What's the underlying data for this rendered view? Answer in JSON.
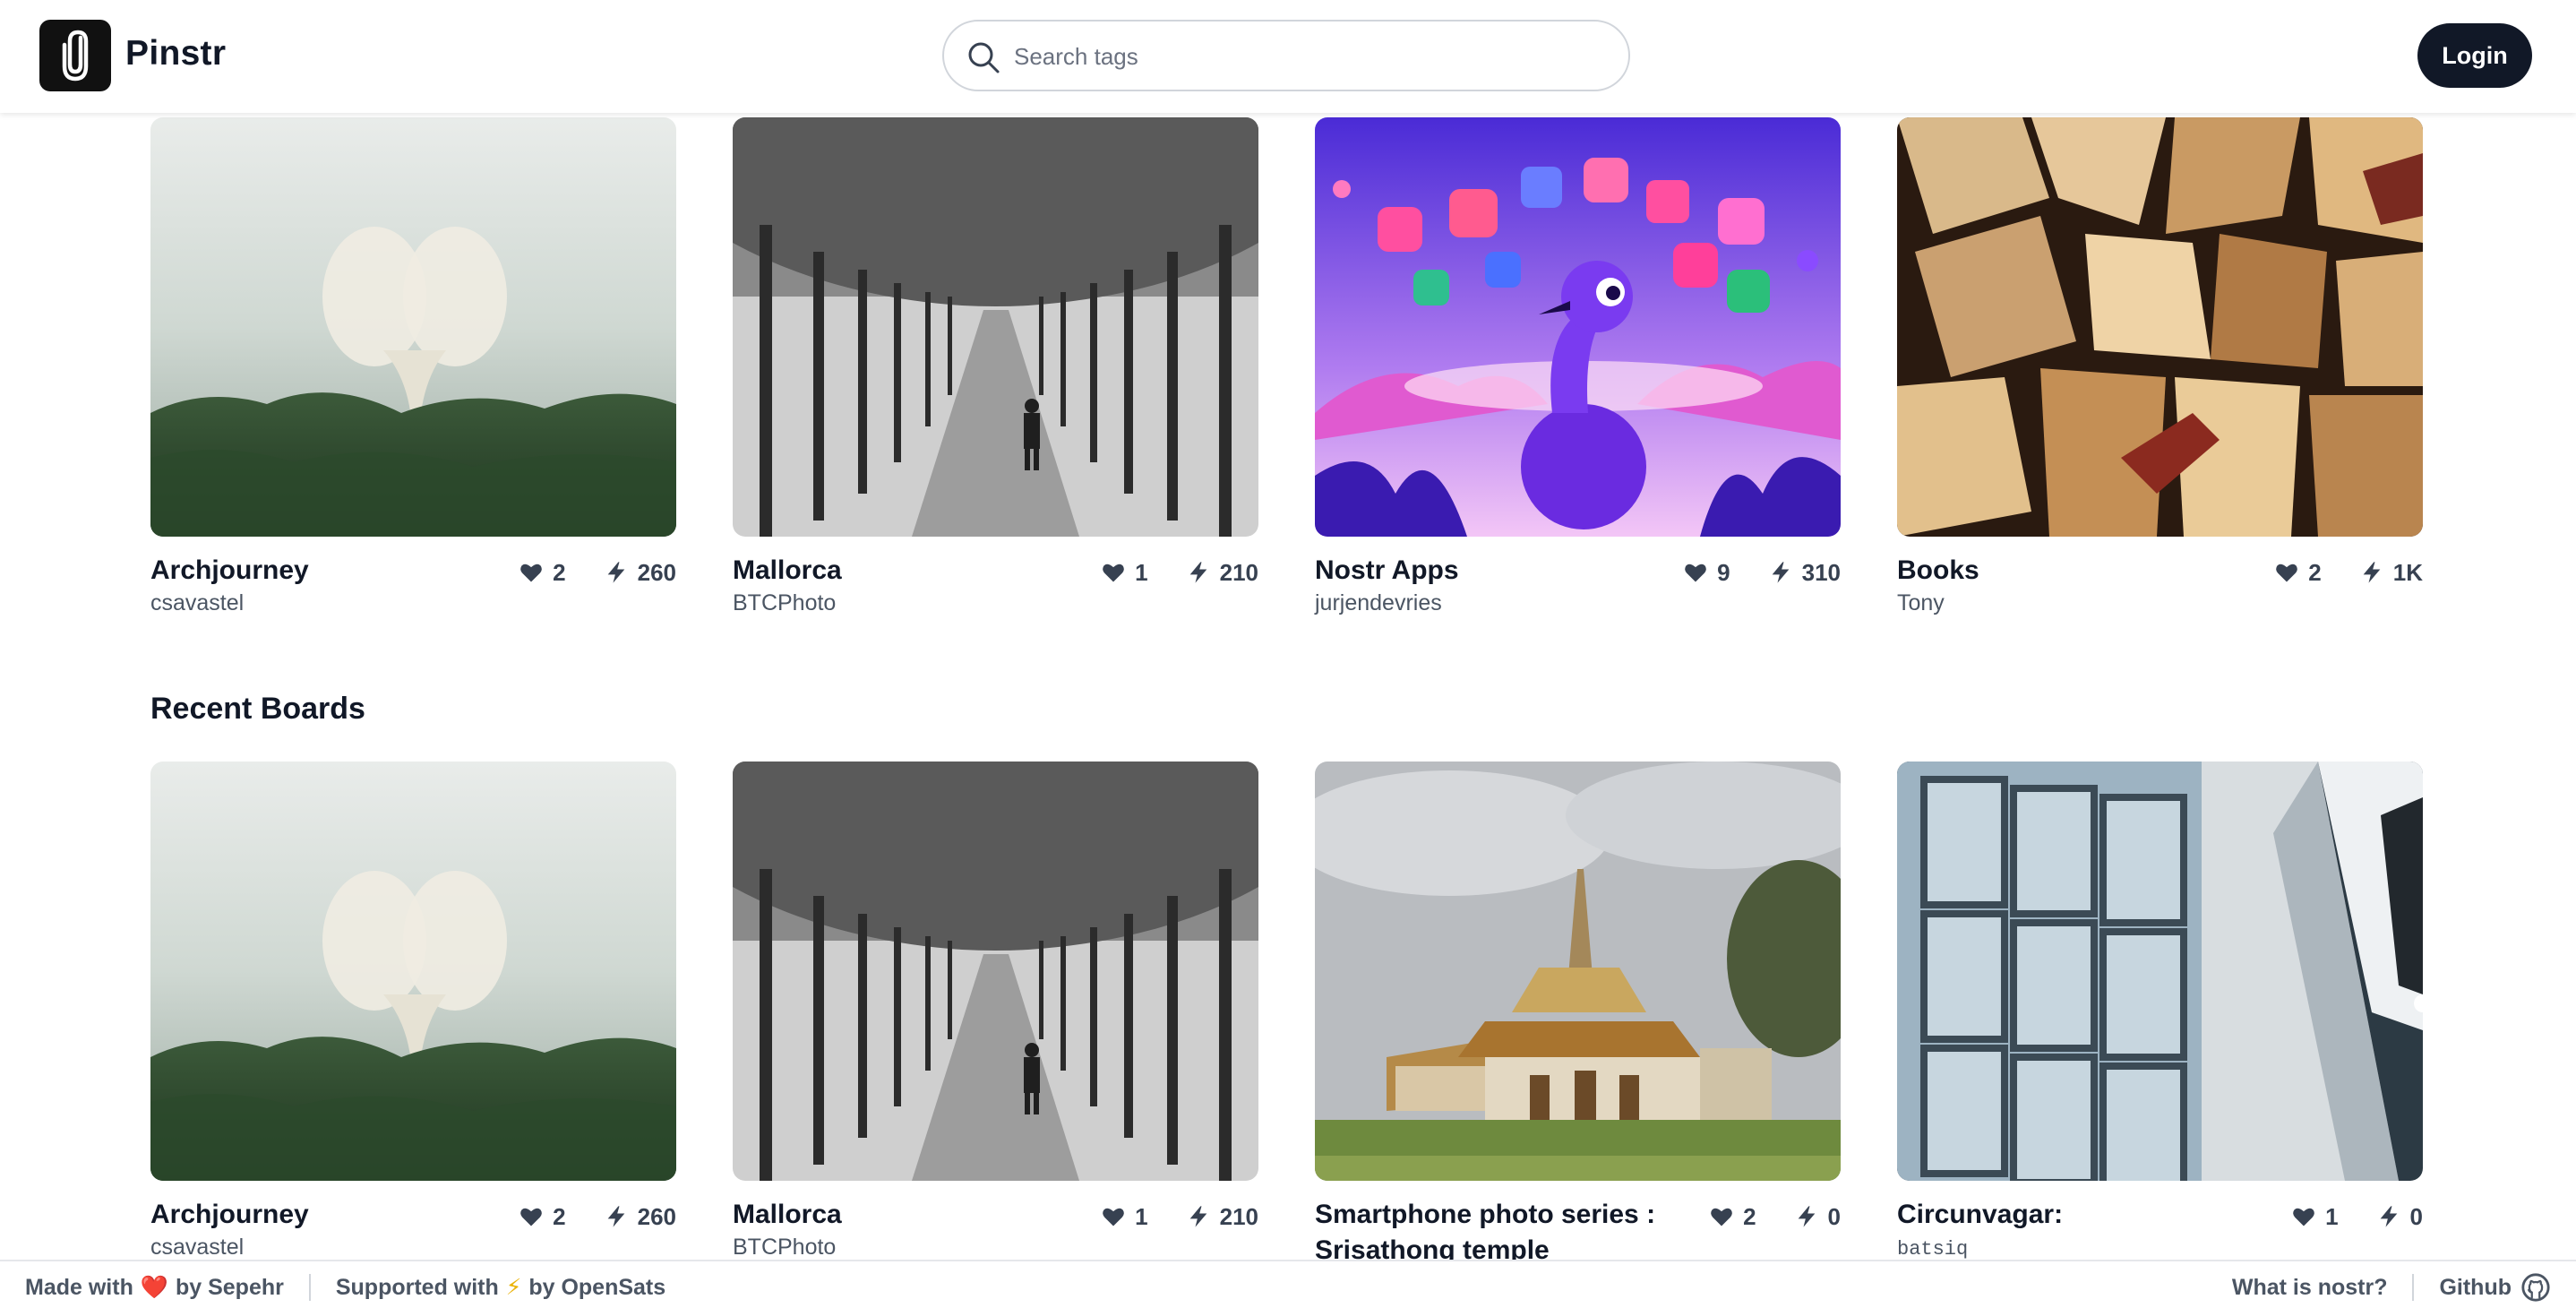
{
  "app": {
    "name": "Pinstr"
  },
  "header": {
    "search_placeholder": "Search tags",
    "login_label": "Login"
  },
  "popular": [
    {
      "title": "Archjourney",
      "author": "csavastel",
      "likes": "2",
      "zaps": "260"
    },
    {
      "title": "Mallorca",
      "author": "BTCPhoto",
      "likes": "1",
      "zaps": "210"
    },
    {
      "title": "Nostr Apps",
      "author": "jurjendevries",
      "likes": "9",
      "zaps": "310"
    },
    {
      "title": "Books",
      "author": "Tony",
      "likes": "2",
      "zaps": "1K"
    }
  ],
  "recent": {
    "heading": "Recent Boards",
    "boards": [
      {
        "title": "Archjourney",
        "author": "csavastel",
        "likes": "2",
        "zaps": "260"
      },
      {
        "title": "Mallorca",
        "author": "BTCPhoto",
        "likes": "1",
        "zaps": "210"
      },
      {
        "title": "Smartphone photo series : Srisathong temple",
        "author": "",
        "likes": "2",
        "zaps": "0"
      },
      {
        "title": "Circunvagar:",
        "author": "batsiq",
        "likes": "1",
        "zaps": "0"
      }
    ]
  },
  "footer": {
    "made_prefix": "Made with",
    "made_glyph": "❤️",
    "made_suffix": "by Sepehr",
    "supported_prefix": "Supported with",
    "supported_glyph": "⚡",
    "supported_suffix": "by OpenSats",
    "what_is_nostr": "What is nostr?",
    "github": "Github"
  },
  "icons": {
    "like": "heart-icon",
    "zap": "lightning-icon",
    "search": "search-icon",
    "github": "github-icon",
    "logo": "paperclip-icon"
  },
  "colors": {
    "primary": "#111827",
    "text_muted": "#4b5563",
    "heart_red": "#dc2626"
  }
}
